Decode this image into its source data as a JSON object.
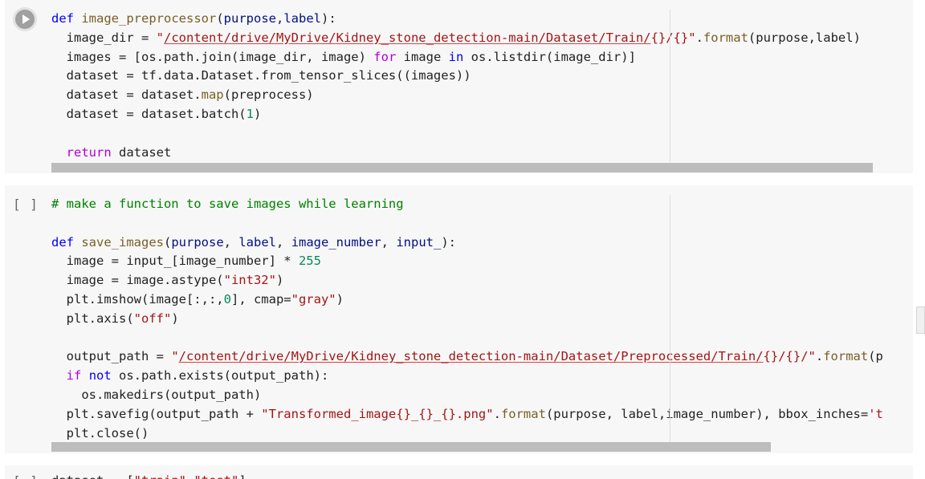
{
  "cells": [
    {
      "gutter": "",
      "lines": [
        [
          {
            "t": "def",
            "c": "kw"
          },
          {
            "t": " "
          },
          {
            "t": "image_preprocessor",
            "c": "fn"
          },
          {
            "t": "("
          },
          {
            "t": "purpose",
            "c": "pl"
          },
          {
            "t": ","
          },
          {
            "t": "label",
            "c": "pl"
          },
          {
            "t": "):"
          }
        ],
        [
          {
            "t": "  image_dir = "
          },
          {
            "t": "\"",
            "c": "st"
          },
          {
            "t": "/content/drive/MyDrive/Kidney_stone_detection-main/Dataset/Train/",
            "c": "st path"
          },
          {
            "t": "{}/{}\"",
            "c": "st"
          },
          {
            "t": "."
          },
          {
            "t": "format",
            "c": "fn"
          },
          {
            "t": "(purpose,label)"
          }
        ],
        [
          {
            "t": "  images = [os.path.join(image_dir, image) "
          },
          {
            "t": "for",
            "c": "ctl"
          },
          {
            "t": " image "
          },
          {
            "t": "in",
            "c": "kw"
          },
          {
            "t": " os.listdir(image_dir)]"
          }
        ],
        [
          {
            "t": "  dataset = tf.data.Dataset.from_tensor_slices((images))"
          }
        ],
        [
          {
            "t": "  dataset = dataset."
          },
          {
            "t": "map",
            "c": "fn"
          },
          {
            "t": "(preprocess)"
          }
        ],
        [
          {
            "t": "  dataset = dataset.batch("
          },
          {
            "t": "1",
            "c": "nm"
          },
          {
            "t": ")"
          }
        ],
        [
          {
            "t": ""
          }
        ],
        [
          {
            "t": "  "
          },
          {
            "t": "return",
            "c": "ctl"
          },
          {
            "t": " dataset"
          }
        ]
      ]
    },
    {
      "gutter": "[ ]",
      "lines": [
        [
          {
            "t": "# make a function to save images while learning",
            "c": "cm"
          }
        ],
        [
          {
            "t": ""
          }
        ],
        [
          {
            "t": "def",
            "c": "kw"
          },
          {
            "t": " "
          },
          {
            "t": "save_images",
            "c": "fn"
          },
          {
            "t": "("
          },
          {
            "t": "purpose",
            "c": "pl"
          },
          {
            "t": ", "
          },
          {
            "t": "label",
            "c": "pl"
          },
          {
            "t": ", "
          },
          {
            "t": "image_number",
            "c": "pl"
          },
          {
            "t": ", "
          },
          {
            "t": "input_",
            "c": "pl"
          },
          {
            "t": "):"
          }
        ],
        [
          {
            "t": "  image = input_[image_number] * "
          },
          {
            "t": "255",
            "c": "nm"
          }
        ],
        [
          {
            "t": "  image = image.astype("
          },
          {
            "t": "\"int32\"",
            "c": "st"
          },
          {
            "t": ")"
          }
        ],
        [
          {
            "t": "  plt.imshow(image[:,:,"
          },
          {
            "t": "0",
            "c": "nm"
          },
          {
            "t": "], cmap="
          },
          {
            "t": "\"gray\"",
            "c": "st"
          },
          {
            "t": ")"
          }
        ],
        [
          {
            "t": "  plt.axis("
          },
          {
            "t": "\"off\"",
            "c": "st"
          },
          {
            "t": ")"
          }
        ],
        [
          {
            "t": ""
          }
        ],
        [
          {
            "t": "  output_path = "
          },
          {
            "t": "\"",
            "c": "st"
          },
          {
            "t": "/content/drive/MyDrive/Kidney_stone_detection-main/Dataset/Preprocessed/Train/",
            "c": "st path"
          },
          {
            "t": "{}/{}/\"",
            "c": "st"
          },
          {
            "t": "."
          },
          {
            "t": "format",
            "c": "fn"
          },
          {
            "t": "(p"
          }
        ],
        [
          {
            "t": "  "
          },
          {
            "t": "if",
            "c": "ctl"
          },
          {
            "t": " "
          },
          {
            "t": "not",
            "c": "kw"
          },
          {
            "t": " os.path.exists(output_path):"
          }
        ],
        [
          {
            "t": "    os.makedirs(output_path)"
          }
        ],
        [
          {
            "t": "  plt.savefig(output_path + "
          },
          {
            "t": "\"Transformed_image{}_{}_{}.png\"",
            "c": "st"
          },
          {
            "t": "."
          },
          {
            "t": "format",
            "c": "fn"
          },
          {
            "t": "(purpose, label,image_number), bbox_inches="
          },
          {
            "t": "'t",
            "c": "st"
          }
        ],
        [
          {
            "t": "  plt.close()"
          }
        ]
      ]
    },
    {
      "gutter": "[ ]",
      "lines": [
        [
          {
            "t": "dataset = ["
          },
          {
            "t": "\"train\"",
            "c": "st"
          },
          {
            "t": ","
          },
          {
            "t": "\"test\"",
            "c": "st"
          },
          {
            "t": "]"
          }
        ]
      ]
    }
  ]
}
